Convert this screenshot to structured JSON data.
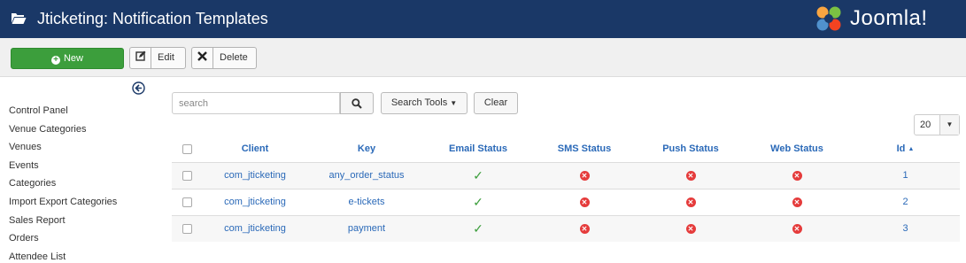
{
  "header": {
    "title": "Jticketing: Notification Templates",
    "logo_text": "Joomla!"
  },
  "toolbar": {
    "new_label": "New",
    "edit_label": "Edit",
    "delete_label": "Delete"
  },
  "sidebar": {
    "items": [
      {
        "label": "Control Panel"
      },
      {
        "label": "Venue Categories"
      },
      {
        "label": "Venues"
      },
      {
        "label": "Events"
      },
      {
        "label": "Categories"
      },
      {
        "label": "Import Export Categories"
      },
      {
        "label": "Sales Report"
      },
      {
        "label": "Orders"
      },
      {
        "label": "Attendee List"
      }
    ]
  },
  "filters": {
    "search_placeholder": "search",
    "search_tools_label": "Search Tools",
    "clear_label": "Clear",
    "list_limit": "20"
  },
  "table": {
    "columns": [
      "Client",
      "Key",
      "Email Status",
      "SMS Status",
      "Push Status",
      "Web Status",
      "Id"
    ],
    "sort_indicator": "▲",
    "rows": [
      {
        "client": "com_jticketing",
        "key": "any_order_status",
        "email": "enabled",
        "sms": "disabled",
        "push": "disabled",
        "web": "disabled",
        "id": "1"
      },
      {
        "client": "com_jticketing",
        "key": "e-tickets",
        "email": "enabled",
        "sms": "disabled",
        "push": "disabled",
        "web": "disabled",
        "id": "2"
      },
      {
        "client": "com_jticketing",
        "key": "payment",
        "email": "enabled",
        "sms": "disabled",
        "push": "disabled",
        "web": "disabled",
        "id": "3"
      }
    ]
  },
  "colors": {
    "header_bg": "#1a3867",
    "new_button": "#3c9e3c",
    "link": "#2a69b8",
    "status_ok": "#3c9e3c",
    "status_error": "#e53b3b"
  },
  "icons": {
    "folder": "folder-open-icon",
    "new": "plus-circle-icon",
    "edit": "edit-icon",
    "delete": "close-icon",
    "search": "search-icon",
    "collapse": "arrow-left-circle-icon",
    "enabled": "check-icon",
    "disabled": "error-circle-icon"
  }
}
